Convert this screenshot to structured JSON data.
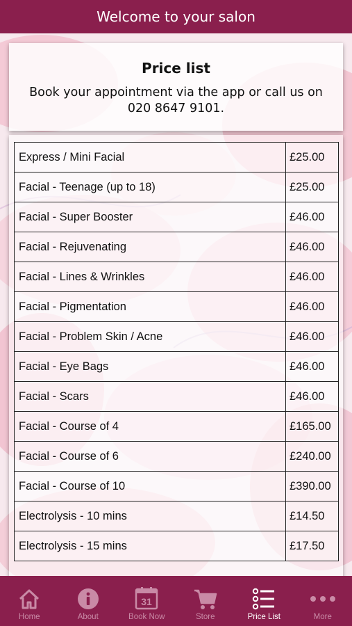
{
  "header": {
    "title": "Welcome to your salon"
  },
  "intro": {
    "title": "Price list",
    "text": "Book your appointment via the app or call us on 020 8647 9101."
  },
  "price_list": [
    {
      "service": "Express / Mini Facial",
      "price": "£25.00"
    },
    {
      "service": "Facial - Teenage (up to 18)",
      "price": "£25.00"
    },
    {
      "service": "Facial - Super Booster",
      "price": "£46.00"
    },
    {
      "service": "Facial - Rejuvenating",
      "price": "£46.00"
    },
    {
      "service": "Facial - Lines & Wrinkles",
      "price": "£46.00"
    },
    {
      "service": "Facial - Pigmentation",
      "price": "£46.00"
    },
    {
      "service": "Facial - Problem Skin / Acne",
      "price": "£46.00"
    },
    {
      "service": "Facial - Eye Bags",
      "price": "£46.00"
    },
    {
      "service": "Facial - Scars",
      "price": "£46.00"
    },
    {
      "service": "Facial - Course of 4",
      "price": "£165.00"
    },
    {
      "service": "Facial - Course of 6",
      "price": "£240.00"
    },
    {
      "service": "Facial - Course of 10",
      "price": "£390.00"
    },
    {
      "service": "Electrolysis - 10 mins",
      "price": "£14.50"
    },
    {
      "service": "Electrolysis - 15 mins",
      "price": "£17.50"
    }
  ],
  "tabbar": {
    "items": [
      {
        "label": "Home",
        "icon": "home-icon"
      },
      {
        "label": "About",
        "icon": "info-icon"
      },
      {
        "label": "Book Now",
        "icon": "calendar-icon",
        "calendar_day": "31"
      },
      {
        "label": "Store",
        "icon": "cart-icon"
      },
      {
        "label": "Price List",
        "icon": "list-icon",
        "active": true
      },
      {
        "label": "More",
        "icon": "more-icon"
      }
    ]
  },
  "colors": {
    "brand": "#8a1f4d",
    "tab_inactive": "#c98aa6",
    "tab_active": "#ffffff"
  }
}
